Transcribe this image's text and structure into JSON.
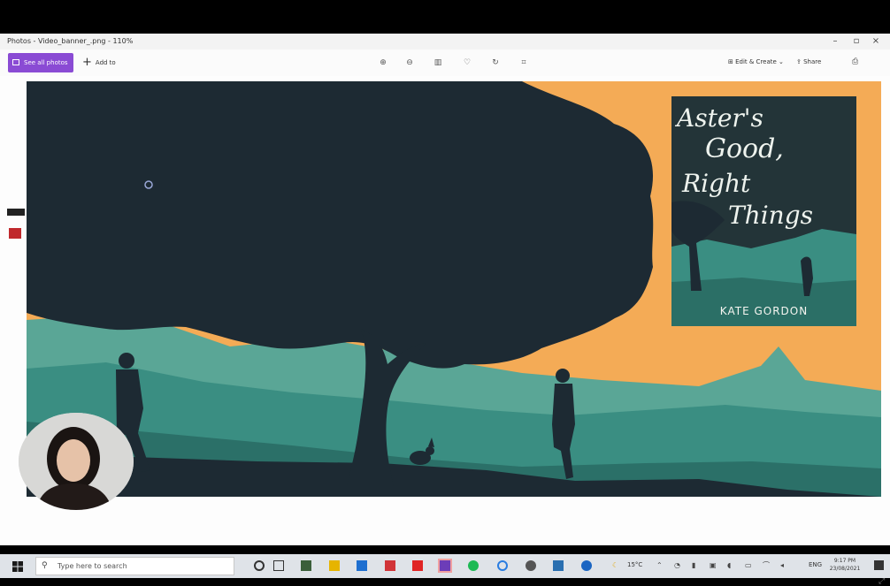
{
  "window": {
    "title": "Photos - Video_banner_.png - 110%",
    "controls": [
      "minimize-icon",
      "maximize-icon",
      "close-icon"
    ]
  },
  "toolbar": {
    "primary_label": "See all photos",
    "add_label": "Add to",
    "icons": [
      "zoom-in-icon",
      "zoom-out-icon",
      "delete-icon",
      "favorite-icon",
      "rotate-icon",
      "crop-icon"
    ],
    "edit_label": "Edit & Create",
    "share_label": "Share",
    "print_icon": "print-icon"
  },
  "image": {
    "book_title_lines": [
      "Aster's",
      "Good,",
      "Right",
      "Things"
    ],
    "book_author": "KATE GORDON",
    "colors": {
      "sky": "#f4ab56",
      "hills": "#3a8e82",
      "silhouette": "#1d2a33"
    }
  },
  "taskbar": {
    "search_placeholder": "Type here to search",
    "weather": "15°C",
    "language": "ENG",
    "time": "9:17 PM",
    "date": "23/08/2021"
  }
}
